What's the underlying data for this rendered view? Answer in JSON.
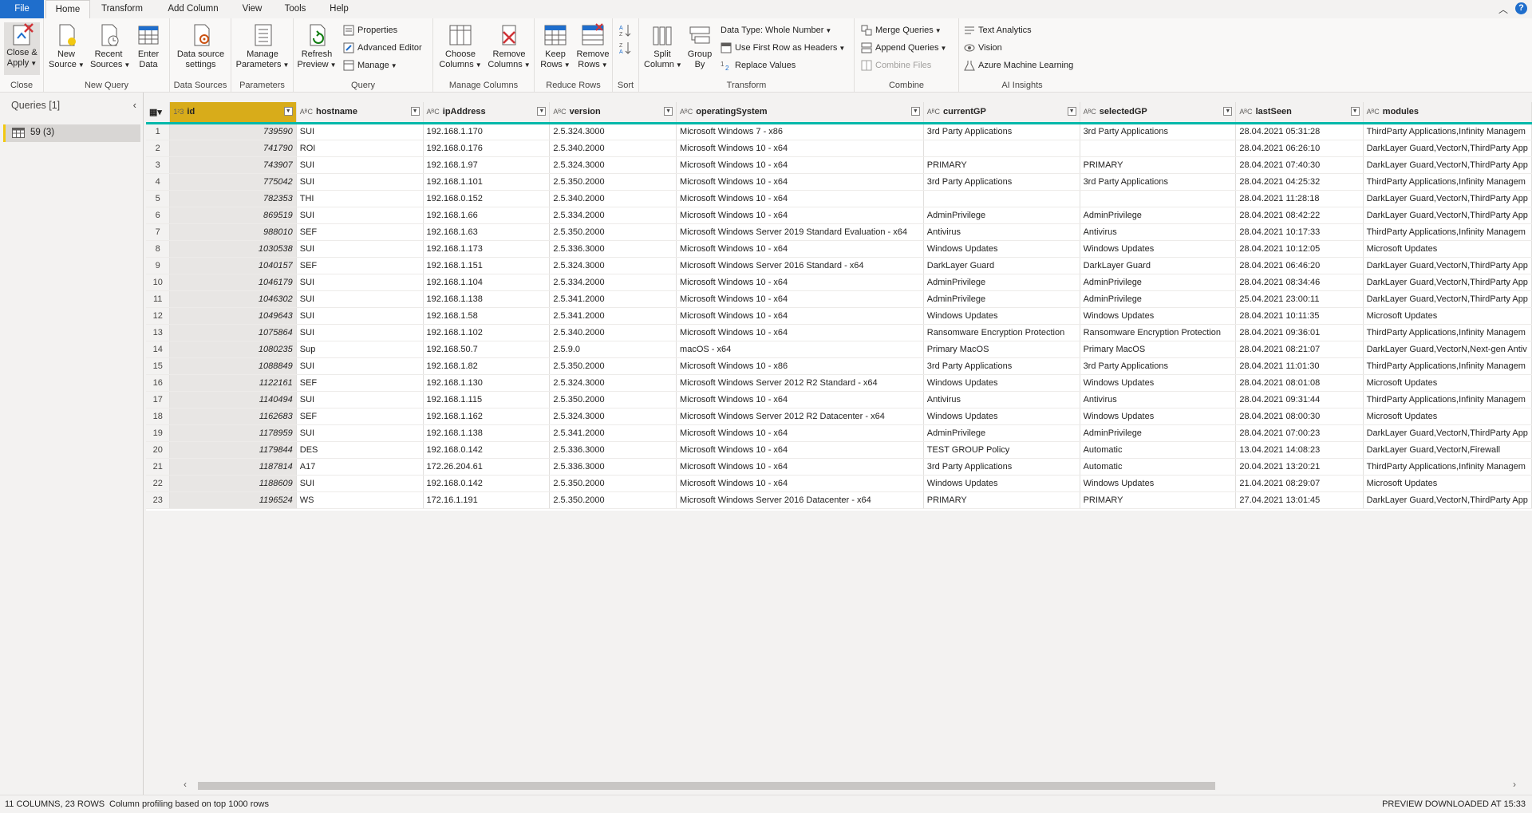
{
  "menu": {
    "tabs": [
      "File",
      "Home",
      "Transform",
      "Add Column",
      "View",
      "Tools",
      "Help"
    ],
    "help_icon": "?"
  },
  "ribbon": {
    "close": {
      "apply_label_1": "Close &",
      "apply_label_2": "Apply",
      "group": "Close"
    },
    "new_query": {
      "new_source_1": "New",
      "new_source_2": "Source",
      "recent_1": "Recent",
      "recent_2": "Sources",
      "enter_1": "Enter",
      "enter_2": "Data",
      "group": "New Query"
    },
    "data_sources": {
      "settings_1": "Data source",
      "settings_2": "settings",
      "group": "Data Sources"
    },
    "parameters": {
      "manage_1": "Manage",
      "manage_2": "Parameters",
      "group": "Parameters"
    },
    "query": {
      "refresh_1": "Refresh",
      "refresh_2": "Preview",
      "properties": "Properties",
      "advanced_editor": "Advanced Editor",
      "manage": "Manage",
      "group": "Query"
    },
    "manage_columns": {
      "choose_1": "Choose",
      "choose_2": "Columns",
      "remove_1": "Remove",
      "remove_2": "Columns",
      "group": "Manage Columns"
    },
    "reduce_rows": {
      "keep_1": "Keep",
      "keep_2": "Rows",
      "remove_1": "Remove",
      "remove_2": "Rows",
      "group": "Reduce Rows"
    },
    "sort": {
      "group": "Sort"
    },
    "transform": {
      "split_1": "Split",
      "split_2": "Column",
      "groupby_1": "Group",
      "groupby_2": "By",
      "data_type": "Data Type: Whole Number",
      "first_row": "Use First Row as Headers",
      "replace": "Replace Values",
      "group": "Transform"
    },
    "combine": {
      "merge": "Merge Queries",
      "append": "Append Queries",
      "combine_files": "Combine Files",
      "group": "Combine"
    },
    "ai": {
      "text": "Text Analytics",
      "vision": "Vision",
      "aml": "Azure Machine Learning",
      "group": "AI Insights"
    }
  },
  "left_pane": {
    "title": "Queries [1]",
    "query_name": "59 (3)"
  },
  "grid": {
    "type_icons": {
      "int": "1²3",
      "text": "AᴮC"
    },
    "columns": [
      "id",
      "hostname",
      "ipAddress",
      "version",
      "operatingSystem",
      "currentGP",
      "selectedGP",
      "lastSeen",
      "modules"
    ],
    "rows": [
      [
        "1",
        "739590",
        "SUI",
        "192.168.1.170",
        "2.5.324.3000",
        "Microsoft Windows 7 - x86",
        "3rd Party Applications",
        "3rd Party Applications",
        "28.04.2021 05:31:28",
        "ThirdParty Applications,Infinity Managem"
      ],
      [
        "2",
        "741790",
        "ROI",
        "192.168.0.176",
        "2.5.340.2000",
        "Microsoft Windows 10 - x64",
        "",
        "",
        "28.04.2021 06:26:10",
        "DarkLayer Guard,VectorN,ThirdParty App"
      ],
      [
        "3",
        "743907",
        "SUI",
        "192.168.1.97",
        "2.5.324.3000",
        "Microsoft Windows 10 - x64",
        "PRIMARY",
        "PRIMARY",
        "28.04.2021 07:40:30",
        "DarkLayer Guard,VectorN,ThirdParty App"
      ],
      [
        "4",
        "775042",
        "SUI",
        "192.168.1.101",
        "2.5.350.2000",
        "Microsoft Windows 10 - x64",
        "3rd Party Applications",
        "3rd Party Applications",
        "28.04.2021 04:25:32",
        "ThirdParty Applications,Infinity Managem"
      ],
      [
        "5",
        "782353",
        "THI",
        "192.168.0.152",
        "2.5.340.2000",
        "Microsoft Windows 10 - x64",
        "",
        "",
        "28.04.2021 11:28:18",
        "DarkLayer Guard,VectorN,ThirdParty App"
      ],
      [
        "6",
        "869519",
        "SUI",
        "192.168.1.66",
        "2.5.334.2000",
        "Microsoft Windows 10 - x64",
        "AdminPrivilege",
        "AdminPrivilege",
        "28.04.2021 08:42:22",
        "DarkLayer Guard,VectorN,ThirdParty App"
      ],
      [
        "7",
        "988010",
        "SEF",
        "192.168.1.63",
        "2.5.350.2000",
        "Microsoft Windows Server 2019 Standard Evaluation - x64",
        "Antivirus",
        "Antivirus",
        "28.04.2021 10:17:33",
        "ThirdParty Applications,Infinity Managem"
      ],
      [
        "8",
        "1030538",
        "SUI",
        "192.168.1.173",
        "2.5.336.3000",
        "Microsoft Windows 10 - x64",
        "Windows Updates",
        "Windows Updates",
        "28.04.2021 10:12:05",
        "Microsoft Updates"
      ],
      [
        "9",
        "1040157",
        "SEF",
        "192.168.1.151",
        "2.5.324.3000",
        "Microsoft Windows Server 2016 Standard - x64",
        "DarkLayer Guard",
        "DarkLayer Guard",
        "28.04.2021 06:46:20",
        "DarkLayer Guard,VectorN,ThirdParty App"
      ],
      [
        "10",
        "1046179",
        "SUI",
        "192.168.1.104",
        "2.5.334.2000",
        "Microsoft Windows 10 - x64",
        "AdminPrivilege",
        "AdminPrivilege",
        "28.04.2021 08:34:46",
        "DarkLayer Guard,VectorN,ThirdParty App"
      ],
      [
        "11",
        "1046302",
        "SUI",
        "192.168.1.138",
        "2.5.341.2000",
        "Microsoft Windows 10 - x64",
        "AdminPrivilege",
        "AdminPrivilege",
        "25.04.2021 23:00:11",
        "DarkLayer Guard,VectorN,ThirdParty App"
      ],
      [
        "12",
        "1049643",
        "SUI",
        "192.168.1.58",
        "2.5.341.2000",
        "Microsoft Windows 10 - x64",
        "Windows Updates",
        "Windows Updates",
        "28.04.2021 10:11:35",
        "Microsoft Updates"
      ],
      [
        "13",
        "1075864",
        "SUI",
        "192.168.1.102",
        "2.5.340.2000",
        "Microsoft Windows 10 - x64",
        "Ransomware Encryption Protection",
        "Ransomware Encryption Protection",
        "28.04.2021 09:36:01",
        "ThirdParty Applications,Infinity Managem"
      ],
      [
        "14",
        "1080235",
        "Sup",
        "192.168.50.7",
        "2.5.9.0",
        "macOS - x64",
        "Primary MacOS",
        "Primary MacOS",
        "28.04.2021 08:21:07",
        "DarkLayer Guard,VectorN,Next-gen Antiv"
      ],
      [
        "15",
        "1088849",
        "SUI",
        "192.168.1.82",
        "2.5.350.2000",
        "Microsoft Windows 10 - x86",
        "3rd Party Applications",
        "3rd Party Applications",
        "28.04.2021 11:01:30",
        "ThirdParty Applications,Infinity Managem"
      ],
      [
        "16",
        "1122161",
        "SEF",
        "192.168.1.130",
        "2.5.324.3000",
        "Microsoft Windows Server 2012 R2 Standard - x64",
        "Windows Updates",
        "Windows Updates",
        "28.04.2021 08:01:08",
        "Microsoft Updates"
      ],
      [
        "17",
        "1140494",
        "SUI",
        "192.168.1.115",
        "2.5.350.2000",
        "Microsoft Windows 10 - x64",
        "Antivirus",
        "Antivirus",
        "28.04.2021 09:31:44",
        "ThirdParty Applications,Infinity Managem"
      ],
      [
        "18",
        "1162683",
        "SEF",
        "192.168.1.162",
        "2.5.324.3000",
        "Microsoft Windows Server 2012 R2 Datacenter - x64",
        "Windows Updates",
        "Windows Updates",
        "28.04.2021 08:00:30",
        "Microsoft Updates"
      ],
      [
        "19",
        "1178959",
        "SUI",
        "192.168.1.138",
        "2.5.341.2000",
        "Microsoft Windows 10 - x64",
        "AdminPrivilege",
        "AdminPrivilege",
        "28.04.2021 07:00:23",
        "DarkLayer Guard,VectorN,ThirdParty App"
      ],
      [
        "20",
        "1179844",
        "DES",
        "192.168.0.142",
        "2.5.336.3000",
        "Microsoft Windows 10 - x64",
        "TEST GROUP Policy",
        "Automatic",
        "13.04.2021 14:08:23",
        "DarkLayer Guard,VectorN,Firewall"
      ],
      [
        "21",
        "1187814",
        "A17",
        "172.26.204.61",
        "2.5.336.3000",
        "Microsoft Windows 10 - x64",
        "3rd Party Applications",
        "Automatic",
        "20.04.2021 13:20:21",
        "ThirdParty Applications,Infinity Managem"
      ],
      [
        "22",
        "1188609",
        "SUI",
        "192.168.0.142",
        "2.5.350.2000",
        "Microsoft Windows 10 - x64",
        "Windows Updates",
        "Windows Updates",
        "21.04.2021 08:29:07",
        "Microsoft Updates"
      ],
      [
        "23",
        "1196524",
        "WS",
        "172.16.1.191",
        "2.5.350.2000",
        "Microsoft Windows Server 2016 Datacenter - x64",
        "PRIMARY",
        "PRIMARY",
        "27.04.2021 13:01:45",
        "DarkLayer Guard,VectorN,ThirdParty App"
      ]
    ]
  },
  "status": {
    "summary": "11 COLUMNS, 23 ROWS",
    "profiling": "Column profiling based on top 1000 rows",
    "preview": "PREVIEW DOWNLOADED AT 15:33"
  },
  "colors": {
    "accent": "#1f6ecc",
    "selected_col": "#d8ac1a",
    "header_rule": "#01b8aa",
    "query_marker": "#f2c811"
  }
}
